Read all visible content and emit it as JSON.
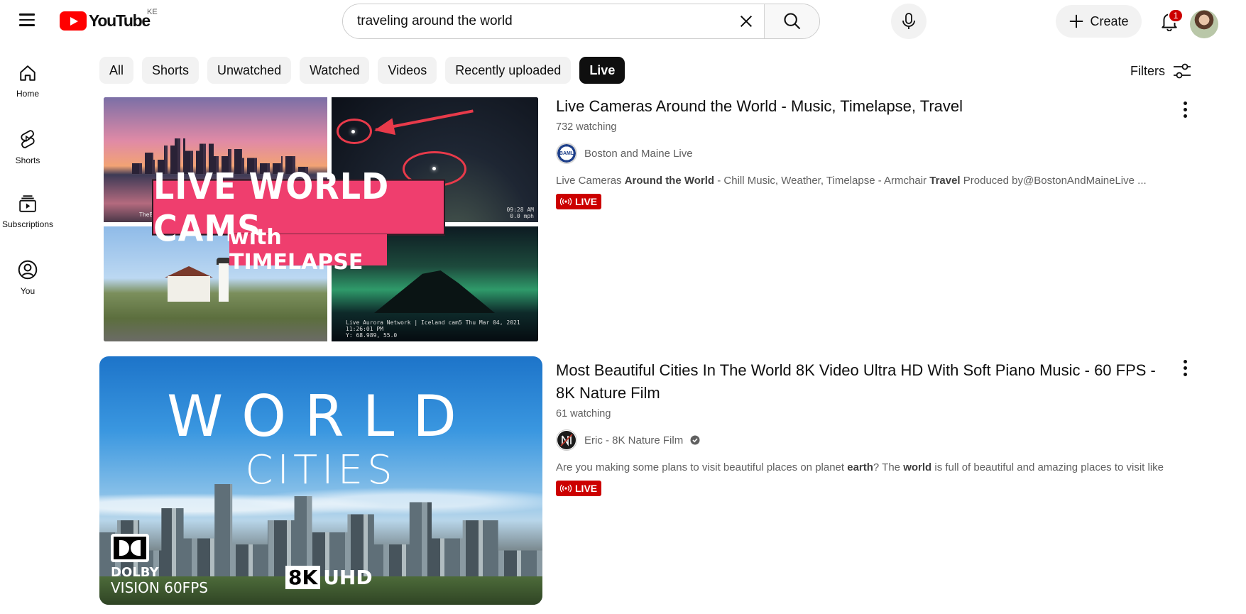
{
  "header": {
    "logo_text": "YouTube",
    "country": "KE",
    "search": {
      "value": "traveling around the world",
      "placeholder": "Search"
    },
    "create_label": "Create",
    "notification_count": "1"
  },
  "sidebar": {
    "items": [
      {
        "label": "Home",
        "icon": "home-icon"
      },
      {
        "label": "Shorts",
        "icon": "shorts-icon"
      },
      {
        "label": "Subscriptions",
        "icon": "subscriptions-icon"
      },
      {
        "label": "You",
        "icon": "you-icon"
      }
    ]
  },
  "chips": [
    {
      "label": "All",
      "active": false
    },
    {
      "label": "Shorts",
      "active": false
    },
    {
      "label": "Unwatched",
      "active": false
    },
    {
      "label": "Watched",
      "active": false
    },
    {
      "label": "Videos",
      "active": false
    },
    {
      "label": "Recently uploaded",
      "active": false
    },
    {
      "label": "Live",
      "active": true
    }
  ],
  "filters_label": "Filters",
  "results": [
    {
      "title": "Live Cameras Around the World - Music, Timelapse, Travel",
      "meta": "732 watching",
      "channel": "Boston and Maine Live",
      "channel_avatar_text": "BAML",
      "desc_parts": [
        "Live Cameras ",
        "Around the World",
        " - Chill Music, Weather, Timelapse - Armchair ",
        "Travel",
        " Produced by@BostonAndMaineLive ..."
      ],
      "badge": "LIVE",
      "thumbnail": {
        "banner": "LIVE WORLD CAMS",
        "sub": "with TIMELAPSE",
        "cap1": "TheBost",
        "cap2a": "09:28 AM",
        "cap2b": "0.0 mph",
        "cap4a": "Live Aurora Network | Iceland cam5  Thu Mar 04, 2021  11:26:01 PM",
        "cap4b": "Y: 68.989,  55.0"
      }
    },
    {
      "title": "Most Beautiful Cities In The World 8K Video Ultra HD With Soft Piano Music - 60 FPS - 8K Nature Film",
      "meta": "61 watching",
      "channel": "Eric - 8K Nature Film",
      "verified": true,
      "desc_parts": [
        "Are you making some plans to visit beautiful places on planet ",
        "earth",
        "? The ",
        "world",
        " is full of beautiful and amazing places to visit like ..."
      ],
      "badge": "LIVE",
      "thumbnail": {
        "word1": "WORLD",
        "word2": "CITIES",
        "dolby": "DOLBY",
        "dolby_sub": "VISION 60FPS",
        "res": "8K",
        "res_sub": "UHD"
      }
    }
  ],
  "colors": {
    "accent_red": "#ff0000",
    "live_red": "#cc0000",
    "chip_bg": "#f2f2f2",
    "chip_active_bg": "#0f0f0f"
  }
}
